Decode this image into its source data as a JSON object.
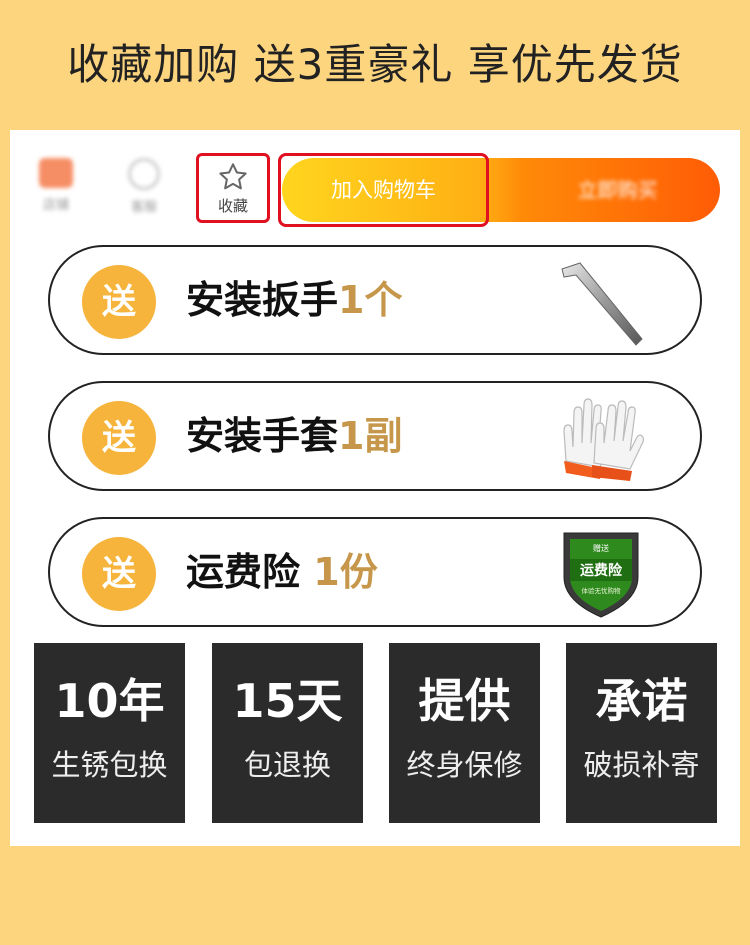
{
  "headline": "收藏加购 送3重豪礼 享优先发货",
  "bar": {
    "shop_label": "店铺",
    "service_label": "客服",
    "favorite_label": "收藏",
    "add_to_cart_label": "加入购物车",
    "buy_now_label": "立即购买",
    "icons": {
      "shop": "shop-icon",
      "service": "clock-icon",
      "favorite": "star-icon"
    }
  },
  "gifts": [
    {
      "badge": "送",
      "name": "安装扳手",
      "qty": "1个",
      "image": "hex-wrench"
    },
    {
      "badge": "送",
      "name": "安装手套",
      "qty": "1副",
      "image": "work-gloves"
    },
    {
      "badge": "送",
      "name": "运费险",
      "qty": "1份",
      "image": "shipping-insurance-shield",
      "shield_top": "赠送",
      "shield_main": "运费险",
      "shield_bottom": "体验无忧购物"
    }
  ],
  "guarantees": [
    {
      "big": "10年",
      "small": "生锈包换"
    },
    {
      "big": "15天",
      "small": "包退换"
    },
    {
      "big": "提供",
      "small": "终身保修"
    },
    {
      "big": "承诺",
      "small": "破损补寄"
    }
  ],
  "colors": {
    "background": "#fdd57f",
    "badge": "#f6b43c",
    "quantity": "#c6974b",
    "highlight_border": "#e01020",
    "guarantee_bg": "#2b2b2b"
  }
}
